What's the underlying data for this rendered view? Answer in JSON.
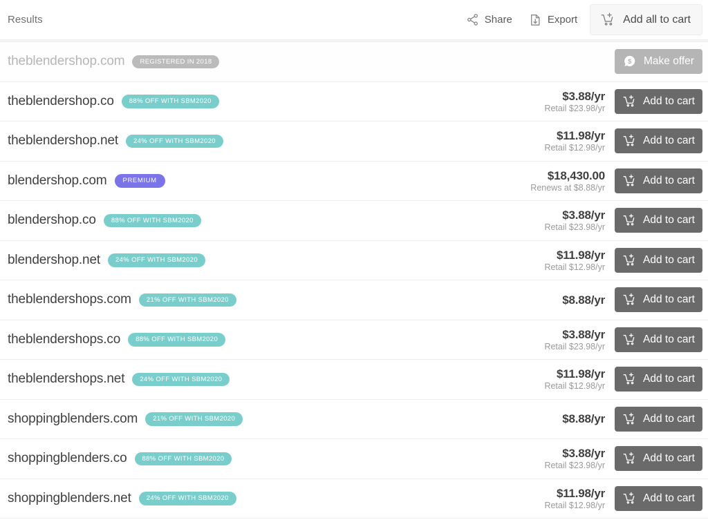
{
  "header": {
    "title": "Results",
    "share_label": "Share",
    "share_icon": "share-icon",
    "export_label": "Export",
    "export_icon": "export-icon",
    "add_all_label": "Add all to cart",
    "add_all_icon": "cart-plus-icon"
  },
  "colors": {
    "badge_teal": "#79cecb",
    "badge_gray": "#bbbbbb",
    "badge_premium": "#7b73e8",
    "cart_button": "#6a6a6a",
    "offer_button": "#b5b5b5",
    "domain_text": "#3f4042",
    "muted_text": "#b6b6b6"
  },
  "rows": [
    {
      "domain": "theblendershop.com",
      "muted": true,
      "badge": {
        "text": "REGISTERED IN 2018",
        "style": "gray"
      },
      "price": "",
      "price_sub": "",
      "action": {
        "label": "Make offer",
        "type": "offer",
        "icon": "offer-dollar-icon"
      }
    },
    {
      "domain": "theblendershop.co",
      "muted": false,
      "badge": {
        "text": "88% OFF WITH SBM2020",
        "style": "teal"
      },
      "price": "$3.88/yr",
      "price_sub": "Retail $23.98/yr",
      "action": {
        "label": "Add to cart",
        "type": "cart",
        "icon": "cart-plus-icon"
      }
    },
    {
      "domain": "theblendershop.net",
      "muted": false,
      "badge": {
        "text": "24% OFF WITH SBM2020",
        "style": "teal"
      },
      "price": "$11.98/yr",
      "price_sub": "Retail $12.98/yr",
      "action": {
        "label": "Add to cart",
        "type": "cart",
        "icon": "cart-plus-icon"
      }
    },
    {
      "domain": "blendershop.com",
      "muted": false,
      "badge": {
        "text": "PREMIUM",
        "style": "premium"
      },
      "price": "$18,430.00",
      "price_sub": "Renews at $8.88/yr",
      "action": {
        "label": "Add to cart",
        "type": "cart",
        "icon": "cart-plus-icon"
      }
    },
    {
      "domain": "blendershop.co",
      "muted": false,
      "badge": {
        "text": "88% OFF WITH SBM2020",
        "style": "teal"
      },
      "price": "$3.88/yr",
      "price_sub": "Retail $23.98/yr",
      "action": {
        "label": "Add to cart",
        "type": "cart",
        "icon": "cart-plus-icon"
      }
    },
    {
      "domain": "blendershop.net",
      "muted": false,
      "badge": {
        "text": "24% OFF WITH SBM2020",
        "style": "teal"
      },
      "price": "$11.98/yr",
      "price_sub": "Retail $12.98/yr",
      "action": {
        "label": "Add to cart",
        "type": "cart",
        "icon": "cart-plus-icon"
      }
    },
    {
      "domain": "theblendershops.com",
      "muted": false,
      "badge": {
        "text": "21% OFF WITH SBM2020",
        "style": "teal"
      },
      "price": "$8.88/yr",
      "price_sub": "",
      "action": {
        "label": "Add to cart",
        "type": "cart",
        "icon": "cart-plus-icon"
      }
    },
    {
      "domain": "theblendershops.co",
      "muted": false,
      "badge": {
        "text": "88% OFF WITH SBM2020",
        "style": "teal"
      },
      "price": "$3.88/yr",
      "price_sub": "Retail $23.98/yr",
      "action": {
        "label": "Add to cart",
        "type": "cart",
        "icon": "cart-plus-icon"
      }
    },
    {
      "domain": "theblendershops.net",
      "muted": false,
      "badge": {
        "text": "24% OFF WITH SBM2020",
        "style": "teal"
      },
      "price": "$11.98/yr",
      "price_sub": "Retail $12.98/yr",
      "action": {
        "label": "Add to cart",
        "type": "cart",
        "icon": "cart-plus-icon"
      }
    },
    {
      "domain": "shoppingblenders.com",
      "muted": false,
      "badge": {
        "text": "21% OFF WITH SBM2020",
        "style": "teal"
      },
      "price": "$8.88/yr",
      "price_sub": "",
      "action": {
        "label": "Add to cart",
        "type": "cart",
        "icon": "cart-plus-icon"
      }
    },
    {
      "domain": "shoppingblenders.co",
      "muted": false,
      "badge": {
        "text": "88% OFF WITH SBM2020",
        "style": "teal"
      },
      "price": "$3.88/yr",
      "price_sub": "Retail $23.98/yr",
      "action": {
        "label": "Add to cart",
        "type": "cart",
        "icon": "cart-plus-icon"
      }
    },
    {
      "domain": "shoppingblenders.net",
      "muted": false,
      "badge": {
        "text": "24% OFF WITH SBM2020",
        "style": "teal"
      },
      "price": "$11.98/yr",
      "price_sub": "Retail $12.98/yr",
      "action": {
        "label": "Add to cart",
        "type": "cart",
        "icon": "cart-plus-icon"
      }
    }
  ]
}
